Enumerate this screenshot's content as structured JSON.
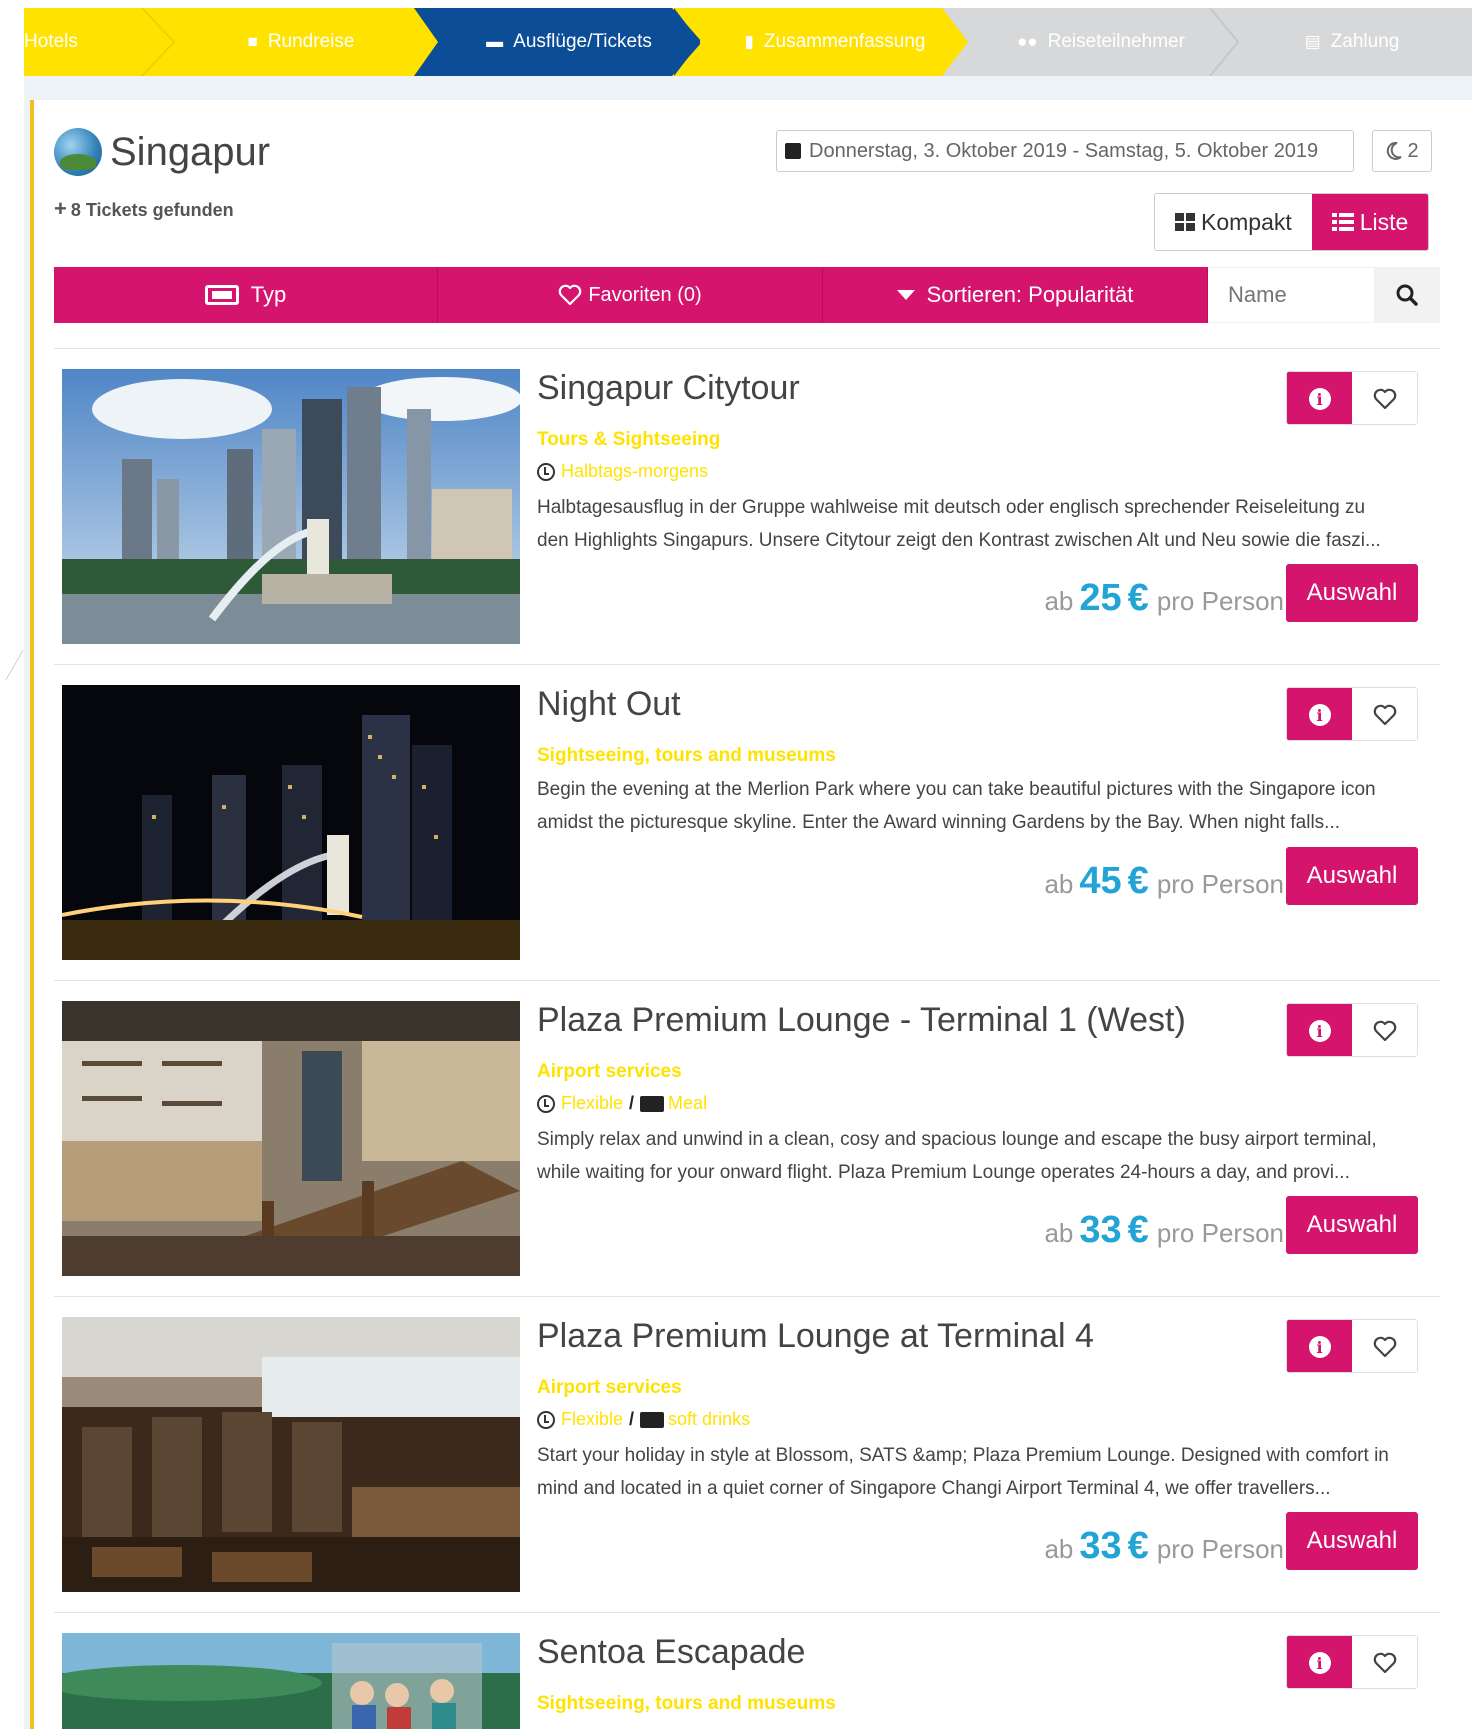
{
  "stepper": {
    "steps": [
      {
        "label": "Hotels",
        "state": "yellow",
        "icon": ""
      },
      {
        "label": "Rundreise",
        "state": "yellow",
        "icon": "bus-icon"
      },
      {
        "label": "Ausflüge/Tickets",
        "state": "active",
        "icon": "ticket-icon"
      },
      {
        "label": "Zusammenfassung",
        "state": "yellow",
        "icon": "document-icon"
      },
      {
        "label": "Reiseteilnehmer",
        "state": "grey",
        "icon": "users-icon"
      },
      {
        "label": "Zahlung",
        "state": "grey",
        "icon": "credit-card-icon"
      }
    ]
  },
  "header": {
    "city": "Singapur",
    "found": "8 Tickets gefunden",
    "dates": "Donnerstag, 3. Oktober 2019 - Samstag, 5. Oktober 2019",
    "nights": "2"
  },
  "view": {
    "kompakt": "Kompakt",
    "liste": "Liste"
  },
  "filters": {
    "typ": "Typ",
    "favoriten": "Favoriten (0)",
    "sortieren": "Sortieren: Popularität",
    "search_placeholder": "Name"
  },
  "colors": {
    "accent": "#d4146d",
    "yellow": "#ffe200",
    "blue": "#0b4d96",
    "price": "#22a4d6"
  },
  "items": [
    {
      "title": "Singapur Citytour",
      "category": "Tours & Sightseeing",
      "duration": "Halbtags-morgens",
      "extra": "",
      "desc1": "Halbtagesausflug in der Gruppe wahlweise mit deutsch oder englisch sprechender Reiseleitung zu",
      "desc2": "den Highlights Singapurs. Unsere Citytour zeigt den Kontrast zwischen Alt und Neu sowie die faszi...",
      "price_prefix": "ab",
      "price": "25",
      "currency": "€",
      "price_suffix": "pro Person",
      "button": "Auswahl"
    },
    {
      "title": "Night Out",
      "category": "Sightseeing, tours and museums",
      "duration": "",
      "extra": "",
      "desc1": "Begin the evening at the Merlion Park where you can take beautiful pictures with the Singapore icon",
      "desc2": "amidst the picturesque skyline. Enter the Award winning Gardens by the Bay. When night falls...",
      "price_prefix": "ab",
      "price": "45",
      "currency": "€",
      "price_suffix": "pro Person",
      "button": "Auswahl"
    },
    {
      "title": "Plaza Premium Lounge - Terminal 1 (West)",
      "category": "Airport services",
      "duration": "Flexible",
      "extra": "Meal",
      "desc1": "Simply relax and unwind in a clean, cosy and spacious lounge and escape the busy airport terminal,",
      "desc2": "while waiting for your onward flight. Plaza Premium Lounge operates 24-hours a day, and provi...",
      "price_prefix": "ab",
      "price": "33",
      "currency": "€",
      "price_suffix": "pro Person",
      "button": "Auswahl"
    },
    {
      "title": "Plaza Premium Lounge at Terminal 4",
      "category": "Airport services",
      "duration": "Flexible",
      "extra": "soft drinks",
      "desc1": "Start your holiday in style at Blossom, SATS &amp; Plaza Premium Lounge. Designed with comfort in",
      "desc2": "mind and located in a quiet corner of Singapore Changi Airport Terminal 4, we offer travellers...",
      "price_prefix": "ab",
      "price": "33",
      "currency": "€",
      "price_suffix": "pro Person",
      "button": "Auswahl"
    },
    {
      "title": "Sentoa Escapade",
      "category": "Sightseeing, tours and museums"
    }
  ]
}
